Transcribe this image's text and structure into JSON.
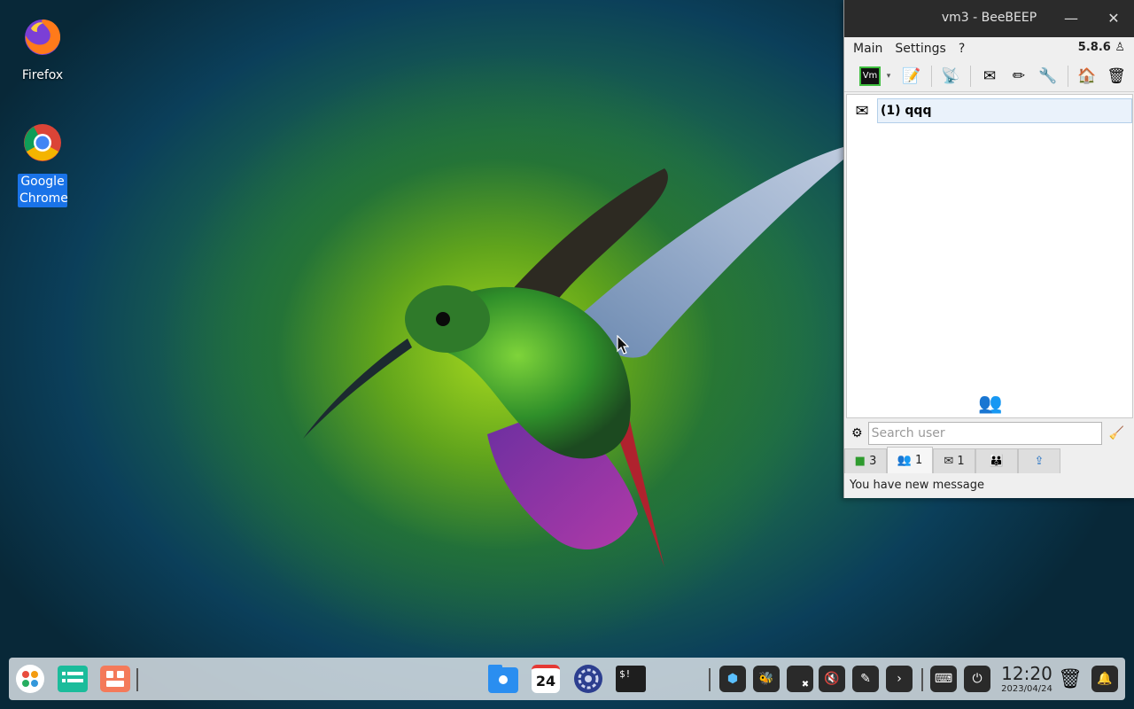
{
  "desktop": {
    "icons": [
      {
        "label": "Firefox"
      },
      {
        "label": "Google Chrome"
      }
    ]
  },
  "window": {
    "title": "vm3 - BeeBEEP",
    "minimize_glyph": "—",
    "close_glyph": "✕",
    "menu": [
      "Main",
      "Settings",
      "?"
    ],
    "version": "5.8.6",
    "toolbar_icons": [
      "vm-status-icon",
      "dropdown-icon",
      "edit-profile-icon",
      "network-icon",
      "message-icon",
      "notepad-icon",
      "tools-icon",
      "home-icon",
      "bin-icon"
    ],
    "toolbar_vm_label": "Vm",
    "users": [
      {
        "label": "(1) qqq"
      }
    ],
    "search": {
      "placeholder": "Search user",
      "value": ""
    },
    "tabs": [
      {
        "label": "3",
        "icon": "users-icon"
      },
      {
        "label": "1",
        "icon": "group-icon"
      },
      {
        "label": "1",
        "icon": "chat-icon"
      },
      {
        "label": "",
        "icon": "group-chat-icon"
      },
      {
        "label": "",
        "icon": "share-icon"
      }
    ],
    "status": "You have new message"
  },
  "taskbar": {
    "calendar_day": "24",
    "terminal_glyph": "$!",
    "clock_time": "12:20",
    "clock_date": "2023/04/24"
  },
  "colors": {
    "accent": "#1a73e8",
    "titlebar": "#2b2b2b"
  }
}
